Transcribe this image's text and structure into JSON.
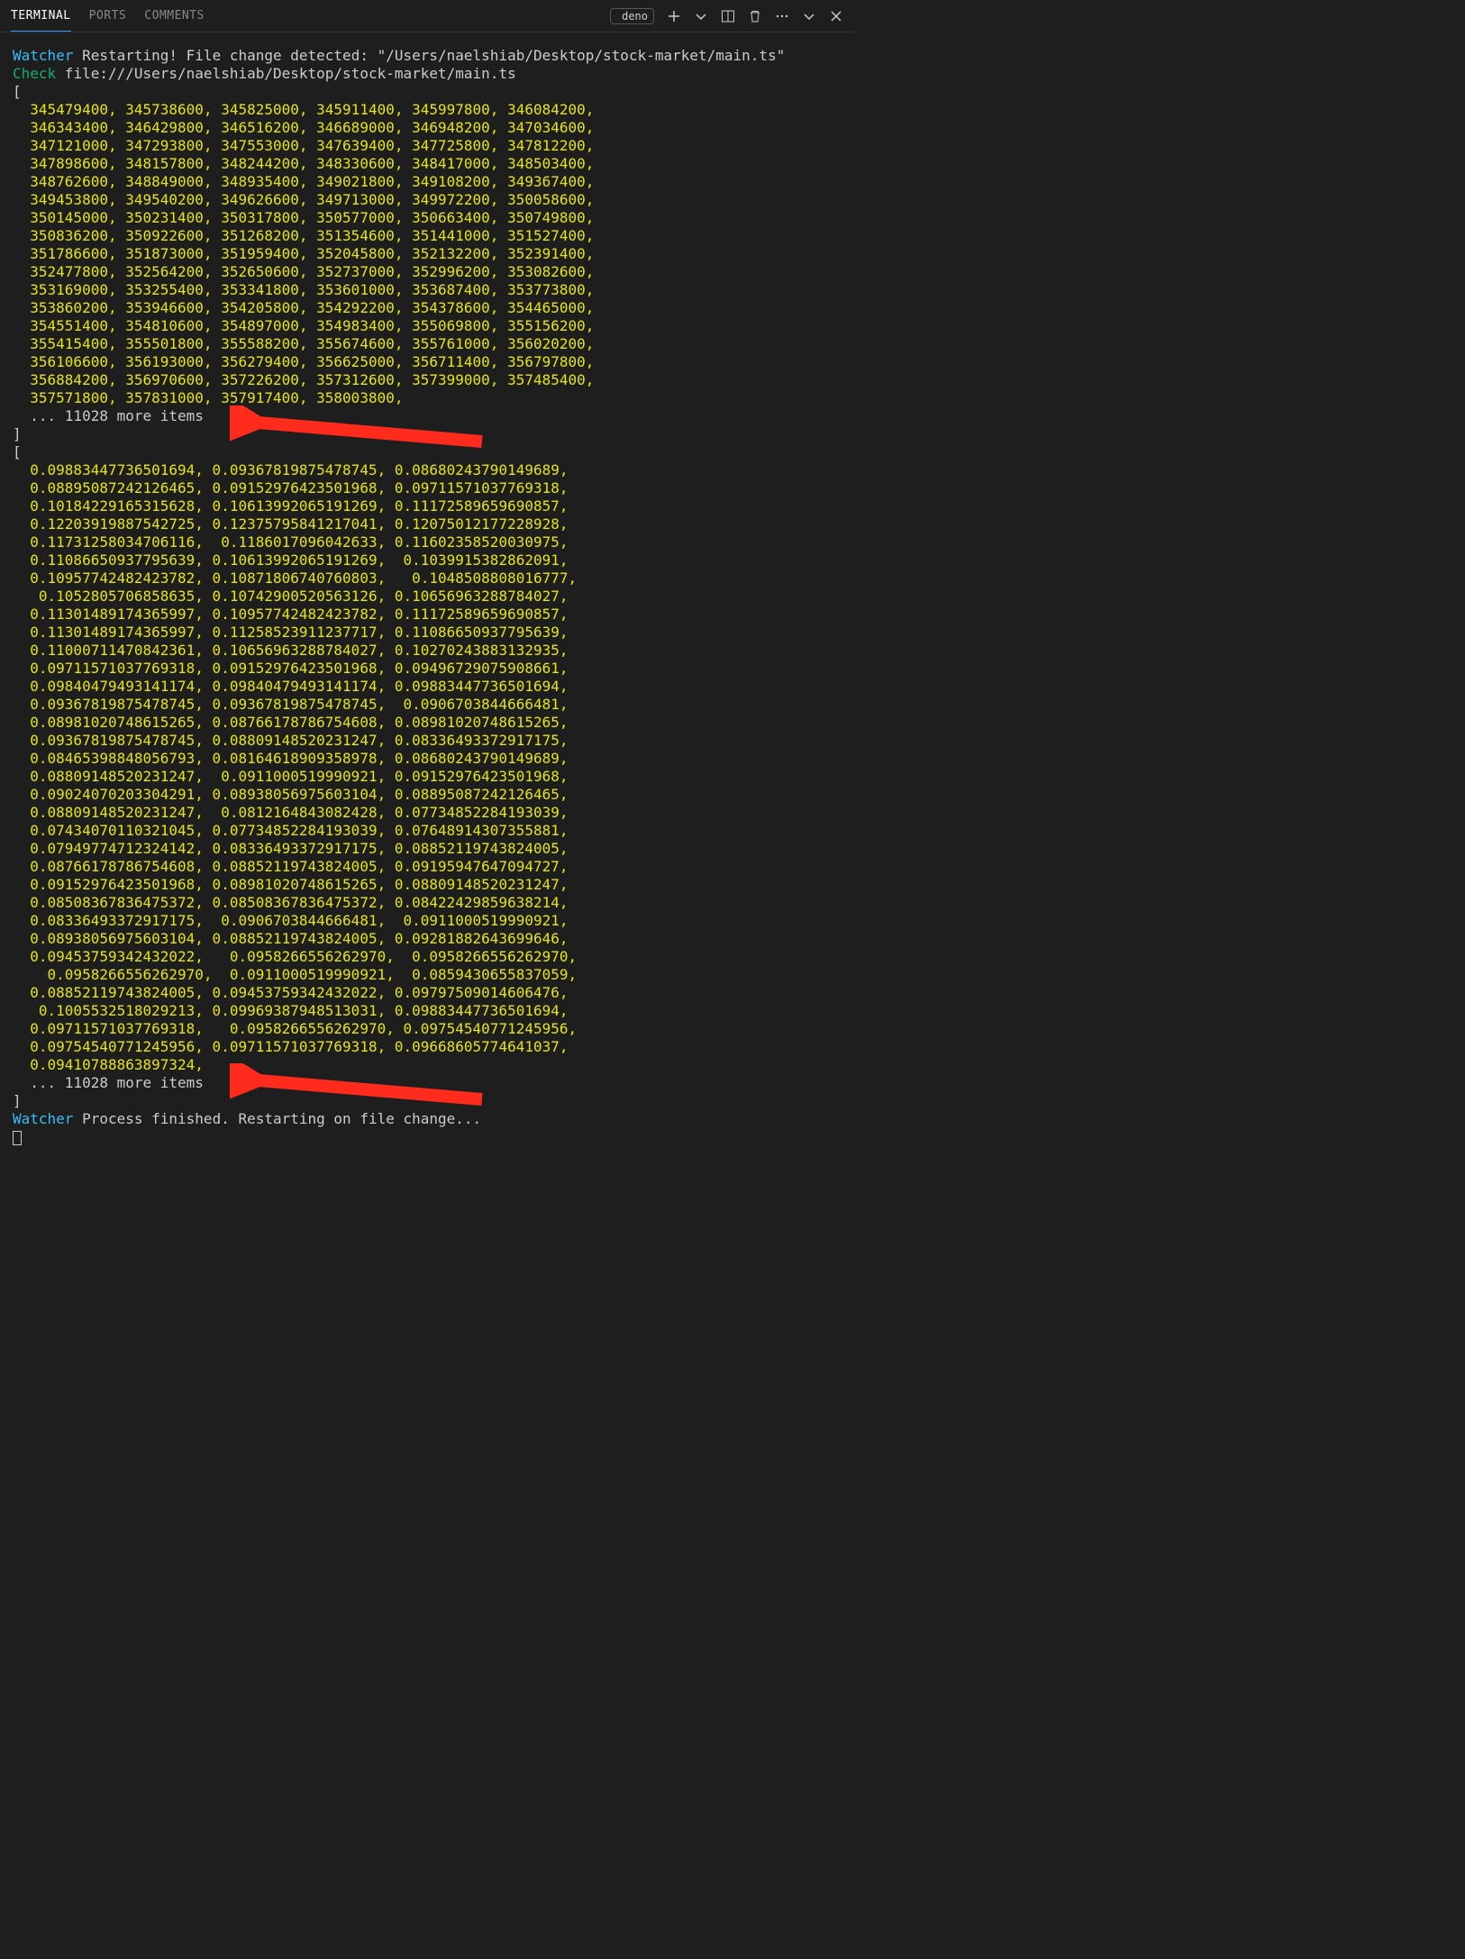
{
  "tabs": {
    "terminal": "TERMINAL",
    "ports": "PORTS",
    "comments": "COMMENTS"
  },
  "toolbar": {
    "deno_label": "deno"
  },
  "watcher": {
    "label": "Watcher",
    "restart_msg": " Restarting! File change detected: \"/Users/naelshiab/Desktop/stock-market/main.ts\"",
    "check_label": "Check",
    "check_path": " file:///Users/naelshiab/Desktop/stock-market/main.ts",
    "finished_msg": " Process finished. Restarting on file change..."
  },
  "array1": {
    "rows": [
      [
        "345479400,",
        "345738600,",
        "345825000,",
        "345911400,",
        "345997800,",
        "346084200,"
      ],
      [
        "346343400,",
        "346429800,",
        "346516200,",
        "346689000,",
        "346948200,",
        "347034600,"
      ],
      [
        "347121000,",
        "347293800,",
        "347553000,",
        "347639400,",
        "347725800,",
        "347812200,"
      ],
      [
        "347898600,",
        "348157800,",
        "348244200,",
        "348330600,",
        "348417000,",
        "348503400,"
      ],
      [
        "348762600,",
        "348849000,",
        "348935400,",
        "349021800,",
        "349108200,",
        "349367400,"
      ],
      [
        "349453800,",
        "349540200,",
        "349626600,",
        "349713000,",
        "349972200,",
        "350058600,"
      ],
      [
        "350145000,",
        "350231400,",
        "350317800,",
        "350577000,",
        "350663400,",
        "350749800,"
      ],
      [
        "350836200,",
        "350922600,",
        "351268200,",
        "351354600,",
        "351441000,",
        "351527400,"
      ],
      [
        "351786600,",
        "351873000,",
        "351959400,",
        "352045800,",
        "352132200,",
        "352391400,"
      ],
      [
        "352477800,",
        "352564200,",
        "352650600,",
        "352737000,",
        "352996200,",
        "353082600,"
      ],
      [
        "353169000,",
        "353255400,",
        "353341800,",
        "353601000,",
        "353687400,",
        "353773800,"
      ],
      [
        "353860200,",
        "353946600,",
        "354205800,",
        "354292200,",
        "354378600,",
        "354465000,"
      ],
      [
        "354551400,",
        "354810600,",
        "354897000,",
        "354983400,",
        "355069800,",
        "355156200,"
      ],
      [
        "355415400,",
        "355501800,",
        "355588200,",
        "355674600,",
        "355761000,",
        "356020200,"
      ],
      [
        "356106600,",
        "356193000,",
        "356279400,",
        "356625000,",
        "356711400,",
        "356797800,"
      ],
      [
        "356884200,",
        "356970600,",
        "357226200,",
        "357312600,",
        "357399000,",
        "357485400,"
      ],
      [
        "357571800,",
        "357831000,",
        "357917400,",
        "358003800,"
      ]
    ],
    "more_items": "... 11028 more items"
  },
  "array2": {
    "rows": [
      [
        "0.09883447736501694,",
        "0.09367819875478745,",
        "0.08680243790149689,"
      ],
      [
        "0.08895087242126465,",
        "0.09152976423501968,",
        "0.09711571037769318,"
      ],
      [
        "0.10184229165315628,",
        "0.10613992065191269,",
        "0.11172589659690857,"
      ],
      [
        "0.12203919887542725,",
        "0.12375795841217041,",
        "0.12075012177228928,"
      ],
      [
        "0.11731258034706116,",
        " 0.1186017096042633,",
        "0.11602358520030975,"
      ],
      [
        "0.11086650937795639,",
        "0.10613992065191269,",
        " 0.1039915382862091,"
      ],
      [
        "0.10957742482423782,",
        "0.10871806740760803,",
        "  0.1048508808016777,"
      ],
      [
        " 0.1052805706858635,",
        "0.10742900520563126,",
        "0.10656963288784027,"
      ],
      [
        "0.11301489174365997,",
        "0.10957742482423782,",
        "0.11172589659690857,"
      ],
      [
        "0.11301489174365997,",
        "0.11258523911237717,",
        "0.11086650937795639,"
      ],
      [
        "0.11000711470842361,",
        "0.10656963288784027,",
        "0.10270243883132935,"
      ],
      [
        "0.09711571037769318,",
        "0.09152976423501968,",
        "0.09496729075908661,"
      ],
      [
        "0.09840479493141174,",
        "0.09840479493141174,",
        "0.09883447736501694,"
      ],
      [
        "0.09367819875478745,",
        "0.09367819875478745,",
        " 0.0906703844666481,"
      ],
      [
        "0.08981020748615265,",
        "0.08766178786754608,",
        "0.08981020748615265,"
      ],
      [
        "0.09367819875478745,",
        "0.08809148520231247,",
        "0.08336493372917175,"
      ],
      [
        "0.08465398848056793,",
        "0.08164618909358978,",
        "0.08680243790149689,"
      ],
      [
        "0.08809148520231247,",
        " 0.0911000519990921,",
        "0.09152976423501968,"
      ],
      [
        "0.09024070203304291,",
        "0.08938056975603104,",
        "0.08895087242126465,"
      ],
      [
        "0.08809148520231247,",
        " 0.0812164843082428,",
        "0.07734852284193039,"
      ],
      [
        "0.07434070110321045,",
        "0.07734852284193039,",
        "0.07648914307355881,"
      ],
      [
        "0.07949774712324142,",
        "0.08336493372917175,",
        "0.08852119743824005,"
      ],
      [
        "0.08766178786754608,",
        "0.08852119743824005,",
        "0.09195947647094727,"
      ],
      [
        "0.09152976423501968,",
        "0.08981020748615265,",
        "0.08809148520231247,"
      ],
      [
        "0.08508367836475372,",
        "0.08508367836475372,",
        "0.08422429859638214,"
      ],
      [
        "0.08336493372917175,",
        " 0.0906703844666481,",
        " 0.0911000519990921,"
      ],
      [
        "0.08938056975603104,",
        "0.08852119743824005,",
        "0.09281882643699646,"
      ],
      [
        "0.09453759342432022,",
        "  0.0958266556262970,",
        " 0.0958266556262970,"
      ],
      [
        "  0.0958266556262970,",
        " 0.0911000519990921,",
        " 0.0859430655837059,"
      ],
      [
        "0.08852119743824005,",
        "0.09453759342432022,",
        "0.09797509014606476,"
      ],
      [
        " 0.1005532518029213,",
        "0.09969387948513031,",
        "0.09883447736501694,"
      ],
      [
        "0.09711571037769318,",
        "  0.0958266556262970,",
        "0.09754540771245956,"
      ],
      [
        "0.09754540771245956,",
        "0.09711571037769318,",
        "0.09668605774641037,"
      ],
      [
        "0.09410788863897324,"
      ]
    ],
    "more_items": "... 11028 more items"
  }
}
